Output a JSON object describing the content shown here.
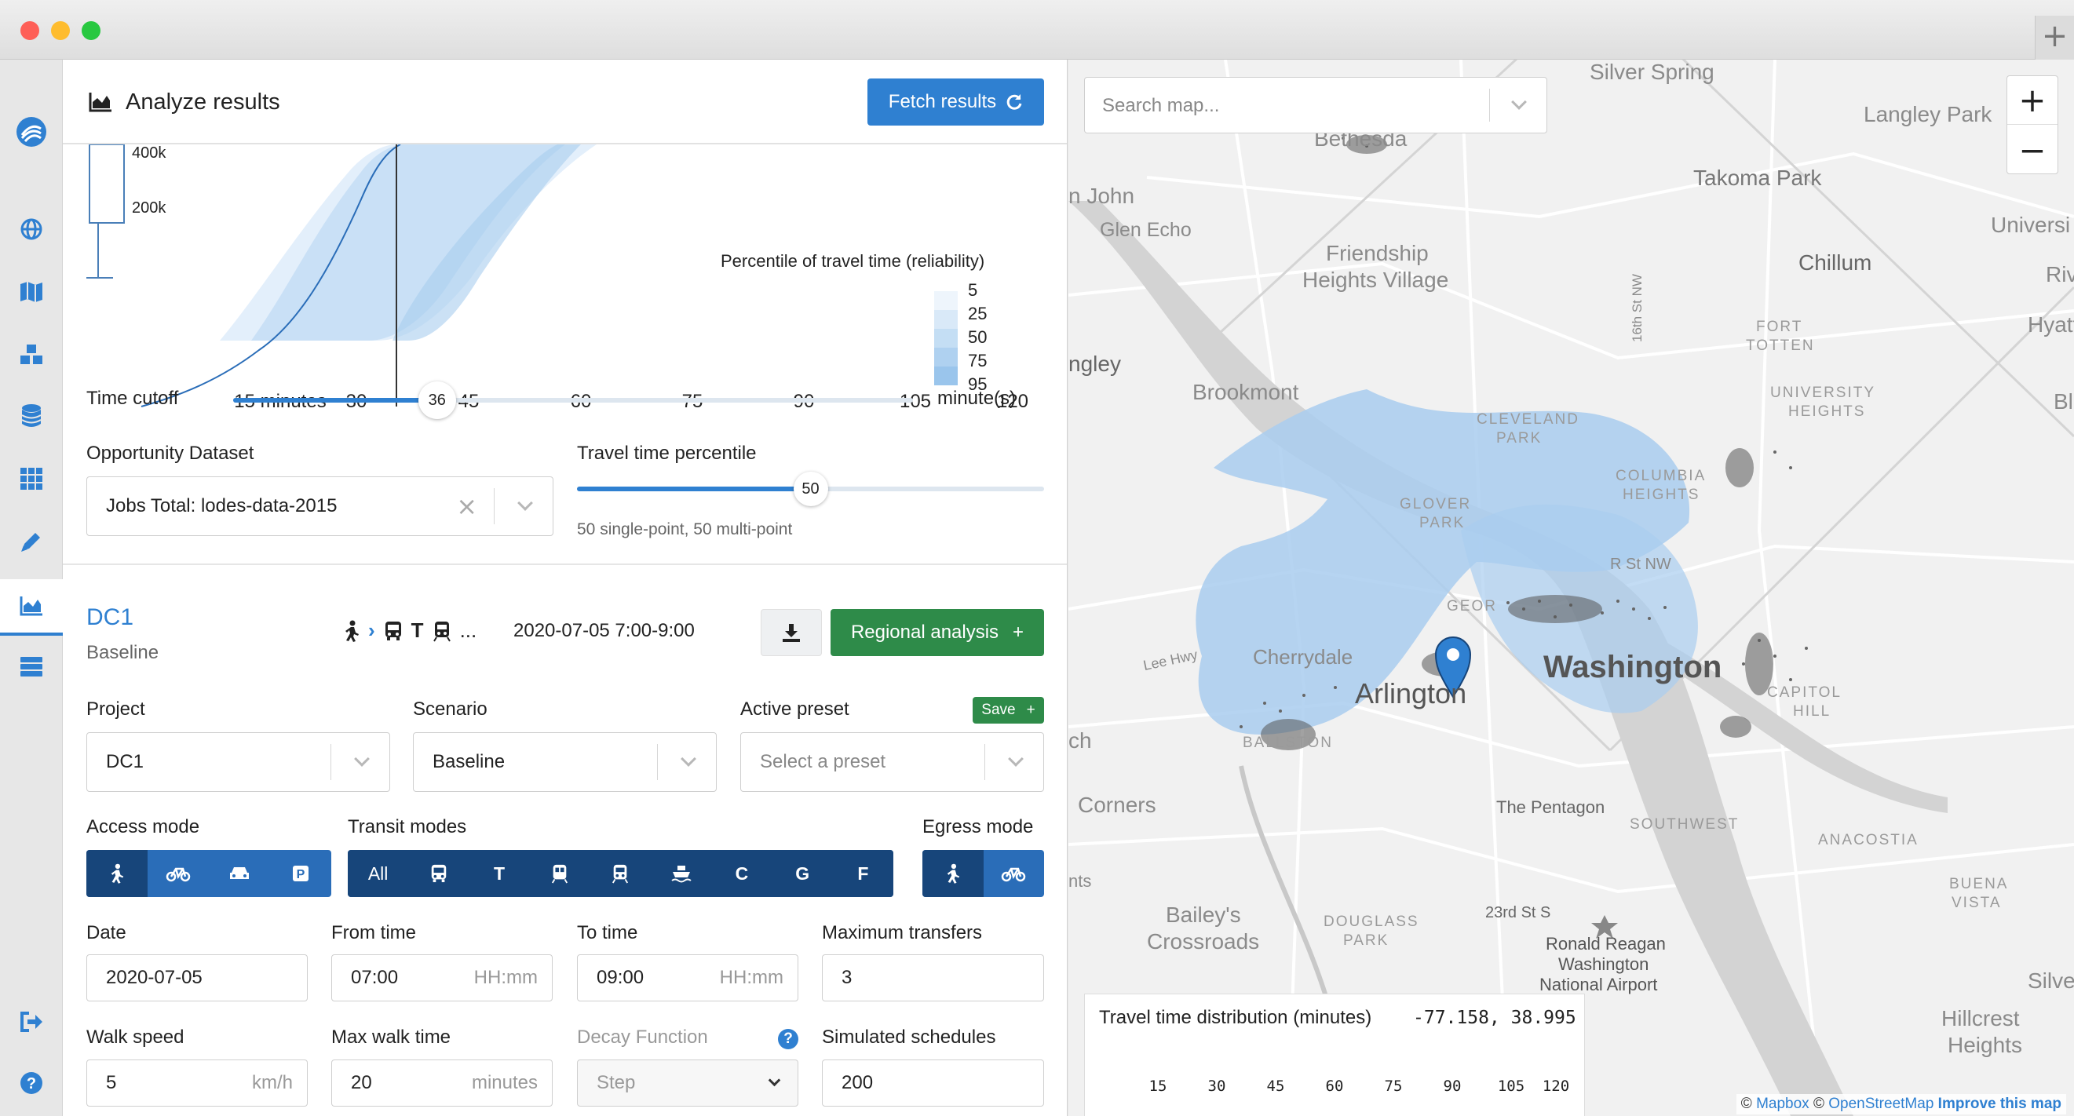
{
  "header": {
    "title": "Analyze results",
    "fetch_label": "Fetch results"
  },
  "chart": {
    "y_ticks": [
      "400k",
      "200k"
    ],
    "x_ticks": [
      "15 minutes",
      "30",
      "45",
      "60",
      "75",
      "90",
      "105",
      "120"
    ],
    "legend_title": "Percentile of travel time (reliability)",
    "legend_values": [
      "5",
      "25",
      "50",
      "75",
      "95"
    ]
  },
  "controls": {
    "time_cutoff_label": "Time cutoff",
    "time_cutoff_value": "36",
    "time_cutoff_fraction": 0.3,
    "time_cutoff_unit": "minute(s)",
    "opportunity_label": "Opportunity Dataset",
    "opportunity_value": "Jobs Total: lodes-data-2015",
    "percentile_label": "Travel time percentile",
    "percentile_value": "50",
    "percentile_fraction": 0.5,
    "percentile_caption": "50 single-point, 50 multi-point"
  },
  "request": {
    "name": "DC1",
    "scenario_subtitle": "Baseline",
    "mode_more": "...",
    "date_time": "2020-07-05  7:00-9:00",
    "regional_label": "Regional analysis",
    "regional_plus": "+",
    "project_label": "Project",
    "project_value": "DC1",
    "scenario_label": "Scenario",
    "scenario_value": "Baseline",
    "preset_label": "Active preset",
    "save_label": "Save",
    "save_plus": "+",
    "preset_placeholder": "Select a preset",
    "access_label": "Access mode",
    "transit_label": "Transit modes",
    "egress_label": "Egress mode",
    "transit_all": "All",
    "transit_letters": [
      "T",
      "C",
      "G",
      "F"
    ],
    "date_label": "Date",
    "date_value": "2020-07-05",
    "from_label": "From time",
    "from_value": "07:00",
    "from_hint": "HH:mm",
    "to_label": "To time",
    "to_value": "09:00",
    "to_hint": "HH:mm",
    "transfers_label": "Maximum transfers",
    "transfers_value": "3",
    "walk_speed_label": "Walk speed",
    "walk_speed_value": "5",
    "walk_speed_unit": "km/h",
    "max_walk_label": "Max walk time",
    "max_walk_value": "20",
    "max_walk_unit": "minutes",
    "decay_label": "Decay Function",
    "decay_value": "Step",
    "decay_help": "?",
    "simulated_label": "Simulated schedules",
    "simulated_value": "200"
  },
  "map": {
    "search_placeholder": "Search map...",
    "zoom_in": "+",
    "zoom_out": "−",
    "labels": {
      "silver_spring": "Silver Spring",
      "langley_park": "Langley Park",
      "bethesda": "Bethesda",
      "takoma_park": "Takoma Park",
      "universi": "Universi",
      "chillum": "Chillum",
      "riv": "Riv",
      "hyatt": "Hyatt",
      "n_john": "n John",
      "glen_echo": "Glen Echo",
      "friendship": "Friendship",
      "heights_village": "Heights Village",
      "fort_totten_1": "FORT",
      "fort_totten_2": "TOTTEN",
      "university_heights_1": "UNIVERSITY",
      "university_heights_2": "HEIGHTS",
      "bla": "Bla",
      "ngley": "ngley",
      "brookmont": "Brookmont",
      "cleveland_1": "CLEVELAND",
      "cleveland_2": "PARK",
      "street_16": "16th St NW",
      "columbia_1": "COLUMBIA",
      "columbia_2": "HEIGHTS",
      "glover_1": "GLOVER",
      "glover_2": "PARK",
      "r_st": "R St NW",
      "georgetown": "GEOR",
      "lee_hwy": "Lee Hwy",
      "cherrydale": "Cherrydale",
      "arlington": "Arlington",
      "washington": "Washington",
      "capitol_1": "CAPITOL",
      "capitol_2": "HILL",
      "ballston": "BALLSTON",
      "ch": "ch",
      "corners": "Corners",
      "pentagon": "The Pentagon",
      "southwest": "SOUTHWEST",
      "anacostia": "ANACOSTIA",
      "buena_1": "BUENA",
      "buena_2": "VISTA",
      "nts": "nts",
      "baileys_1": "Bailey's",
      "baileys_2": "Crossroads",
      "douglass_1": "DOUGLASS",
      "douglass_2": "PARK",
      "23rd": "23rd St S",
      "reagan_1": "Ronald Reagan",
      "reagan_2": "Washington",
      "reagan_3": "National Airport",
      "silver_h": "Silver H",
      "hillcrest_1": "Hillcrest",
      "hillcrest_2": "Heights"
    },
    "dist_title": "Travel time distribution (minutes)",
    "coords": "-77.158, 38.995",
    "dist_ticks": [
      "15",
      "30",
      "45",
      "60",
      "75",
      "90",
      "105",
      "120"
    ],
    "attribution_prefix": "©",
    "mapbox": "Mapbox",
    "attribution_mid": "©",
    "osm": "OpenStreetMap",
    "improve": "Improve this map"
  },
  "colors": {
    "accent_blue": "#2f80d1",
    "dark_blue": "#17457a",
    "mode_blue": "#2a6db8",
    "green": "#2e8b49",
    "isochrone": "#a9cdef"
  }
}
